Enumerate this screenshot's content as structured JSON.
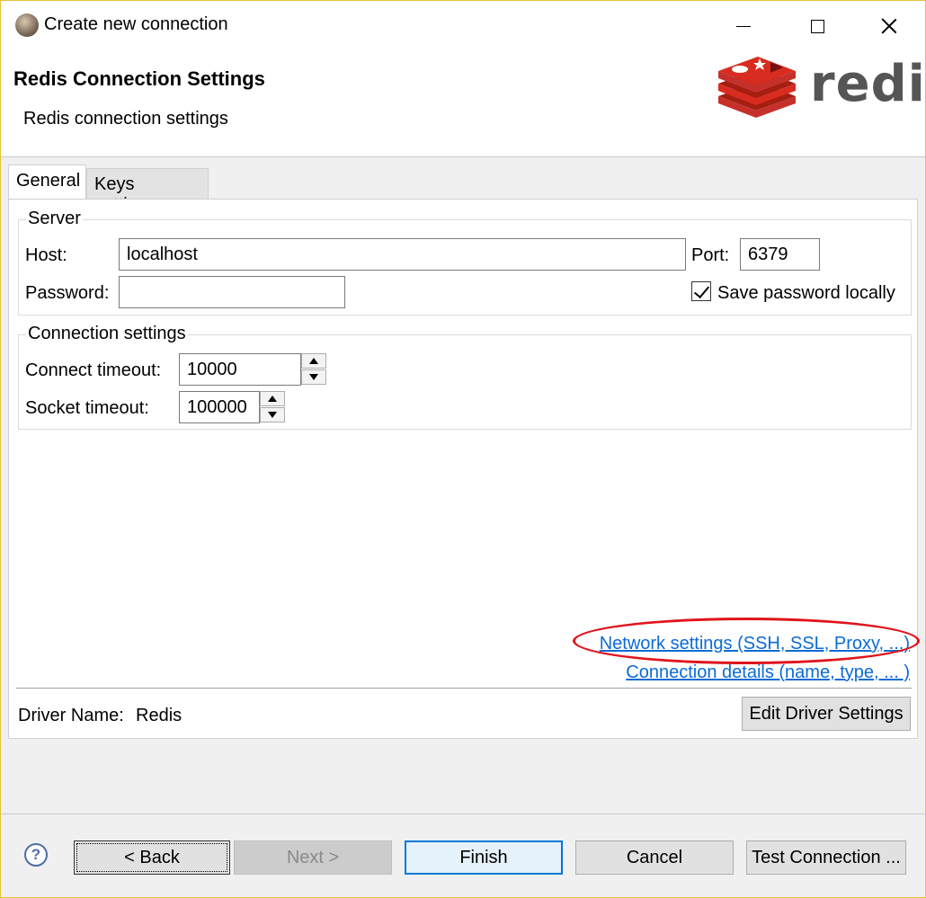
{
  "window": {
    "title": "Create new connection"
  },
  "header": {
    "title": "Redis Connection Settings",
    "subtitle": "Redis connection settings",
    "logo_text": "redis"
  },
  "tabs": [
    {
      "label": "General",
      "active": true
    },
    {
      "label": "Keys settings",
      "active": false
    }
  ],
  "server": {
    "group_label": "Server",
    "host_label": "Host:",
    "host_value": "localhost",
    "port_label": "Port:",
    "port_value": "6379",
    "password_label": "Password:",
    "password_value": "",
    "save_password_label": "Save password locally",
    "save_password_checked": true
  },
  "connection_settings": {
    "group_label": "Connection settings",
    "connect_timeout_label": "Connect timeout:",
    "connect_timeout_value": "10000",
    "socket_timeout_label": "Socket timeout:",
    "socket_timeout_value": "100000"
  },
  "links": {
    "network_settings": "Network settings (SSH, SSL, Proxy, ...)",
    "connection_details": "Connection details (name, type, ... )"
  },
  "driver": {
    "label": "Driver Name:",
    "value": "Redis",
    "edit_button": "Edit Driver Settings"
  },
  "footer": {
    "help_icon_glyph": "?",
    "back": "< Back",
    "next": "Next >",
    "finish": "Finish",
    "cancel": "Cancel",
    "test_connection": "Test Connection ..."
  },
  "colors": {
    "link": "#0a6bd6",
    "highlight": "#e0141c",
    "redis_red": "#d82c20"
  }
}
